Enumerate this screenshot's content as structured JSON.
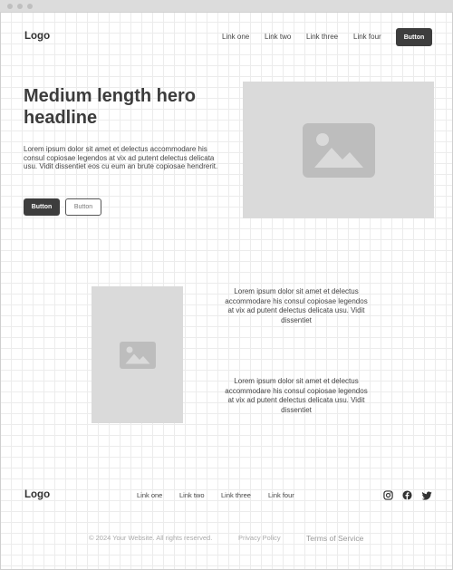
{
  "header": {
    "logo": "Logo",
    "links": [
      "Link one",
      "Link two",
      "Link three",
      "Link four"
    ],
    "button_label": "Button"
  },
  "hero": {
    "headline": "Medium length hero headline",
    "body": "Lorem ipsum dolor sit amet et delectus accommodare his consul copiosae legendos at vix ad putent delectus delicata usu. Vidit dissentiet eos cu eum an brute copiosae hendrerit.",
    "primary_button": "Button",
    "secondary_button": "Button",
    "image_icon": "image-placeholder-icon"
  },
  "features": {
    "image_icon": "image-placeholder-icon",
    "paragraph_1": "Lorem ipsum dolor sit amet et delectus accommodare his consul copiosae legendos at vix ad putent delectus delicata usu. Vidit dissentiet",
    "paragraph_2": "Lorem ipsum dolor sit amet et delectus accommodare his consul copiosae legendos at vix ad putent delectus delicata usu. Vidit dissentiet"
  },
  "footer": {
    "logo": "Logo",
    "links": [
      "Link one",
      "Link two",
      "Link three",
      "Link four"
    ],
    "social_icons": [
      "instagram-icon",
      "facebook-icon",
      "twitter-icon"
    ],
    "copyright": "© 2024 Your Website. All rights reserved.",
    "privacy": "Privacy Policy",
    "terms": "Terms of Service"
  },
  "colors": {
    "button_dark": "#3d3d3d",
    "placeholder_bg": "#dadada",
    "placeholder_icon": "#bdbdbd"
  }
}
